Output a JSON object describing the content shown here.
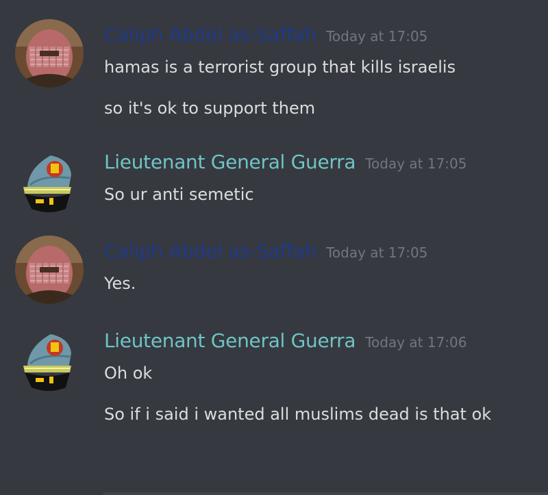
{
  "colors": {
    "background": "#36393f",
    "caliph_name": "#1f3a8a",
    "general_name": "#6fc4c8",
    "timestamp": "#72767d",
    "message_text": "#dcddde"
  },
  "messages": [
    {
      "author": "Caliph Abdel as-Saffah",
      "timestamp": "Today at 17:05",
      "avatar": "keffiyeh-avatar-icon",
      "lines": [
        "hamas is a terrorist group that kills israelis",
        "so it's ok to support them"
      ]
    },
    {
      "author": "Lieutenant General Guerra",
      "timestamp": "Today at 17:05",
      "avatar": "military-cap-avatar-icon",
      "lines": [
        "So ur anti semetic"
      ]
    },
    {
      "author": "Caliph Abdel as-Saffah",
      "timestamp": "Today at 17:05",
      "avatar": "keffiyeh-avatar-icon",
      "lines": [
        "Yes."
      ]
    },
    {
      "author": "Lieutenant General Guerra",
      "timestamp": "Today at 17:06",
      "avatar": "military-cap-avatar-icon",
      "lines": [
        "Oh ok",
        "So if i said i wanted all muslims dead is that ok"
      ]
    }
  ]
}
